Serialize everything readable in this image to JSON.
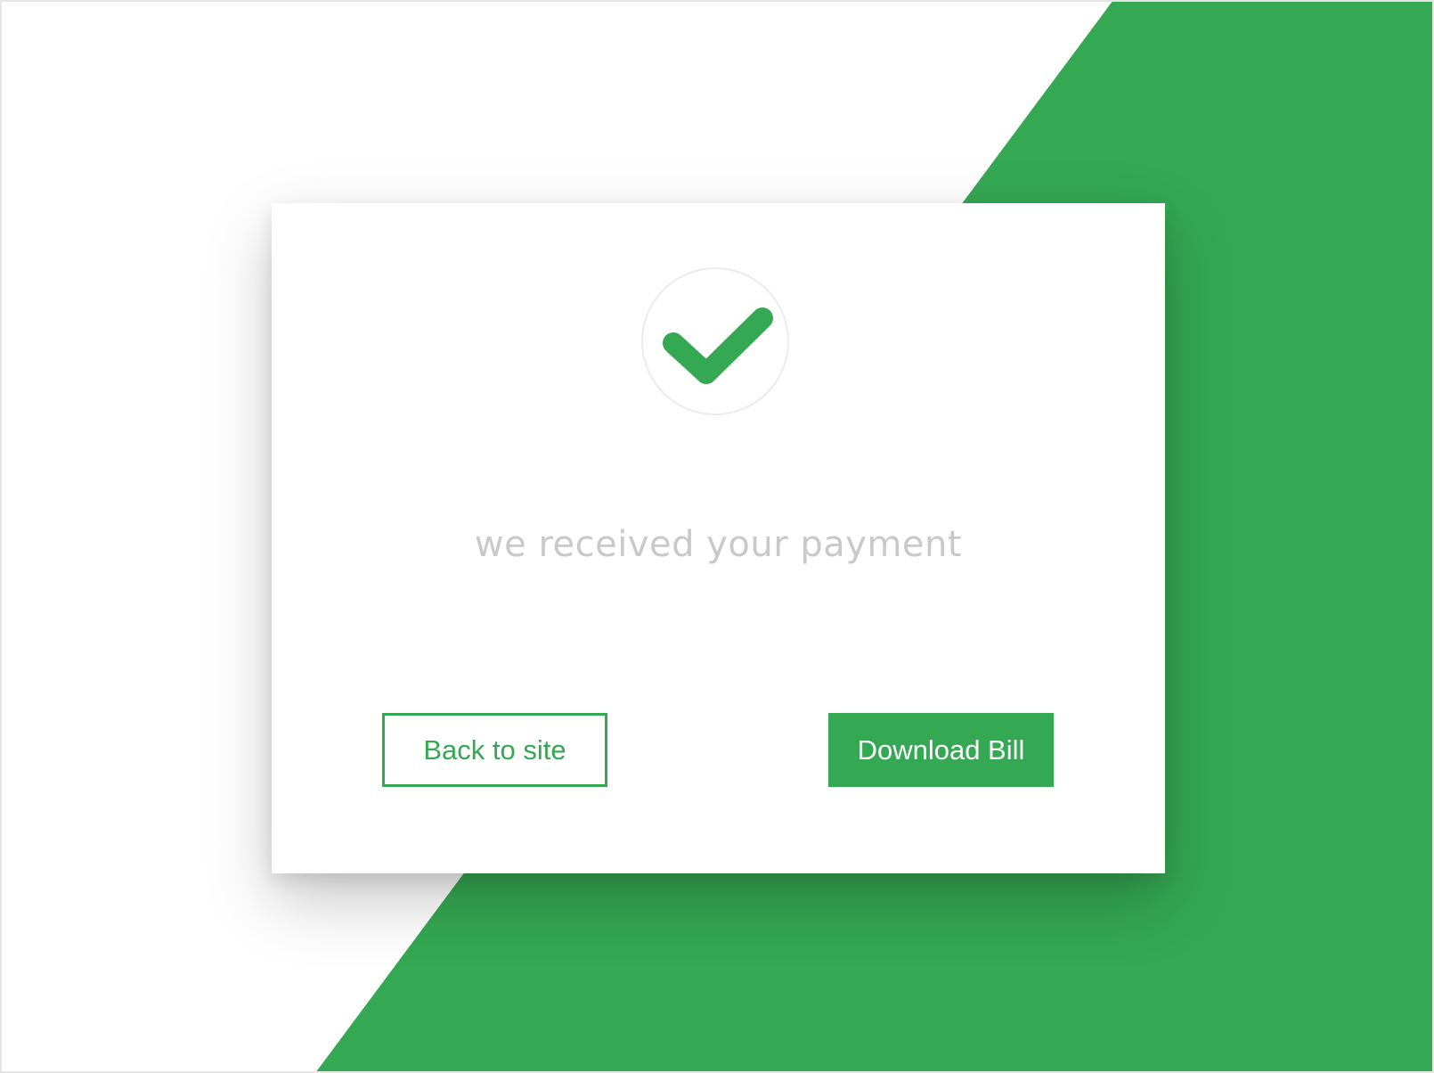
{
  "colors": {
    "accent": "#35a853",
    "accent_shadow": "#2f9a4b",
    "message_text": "#c9c9c9",
    "background": "#ffffff"
  },
  "icon": {
    "name": "checkmark-icon"
  },
  "message": {
    "text": "we received your payment"
  },
  "actions": {
    "back_label": "Back to site",
    "download_label": "Download Bill"
  }
}
